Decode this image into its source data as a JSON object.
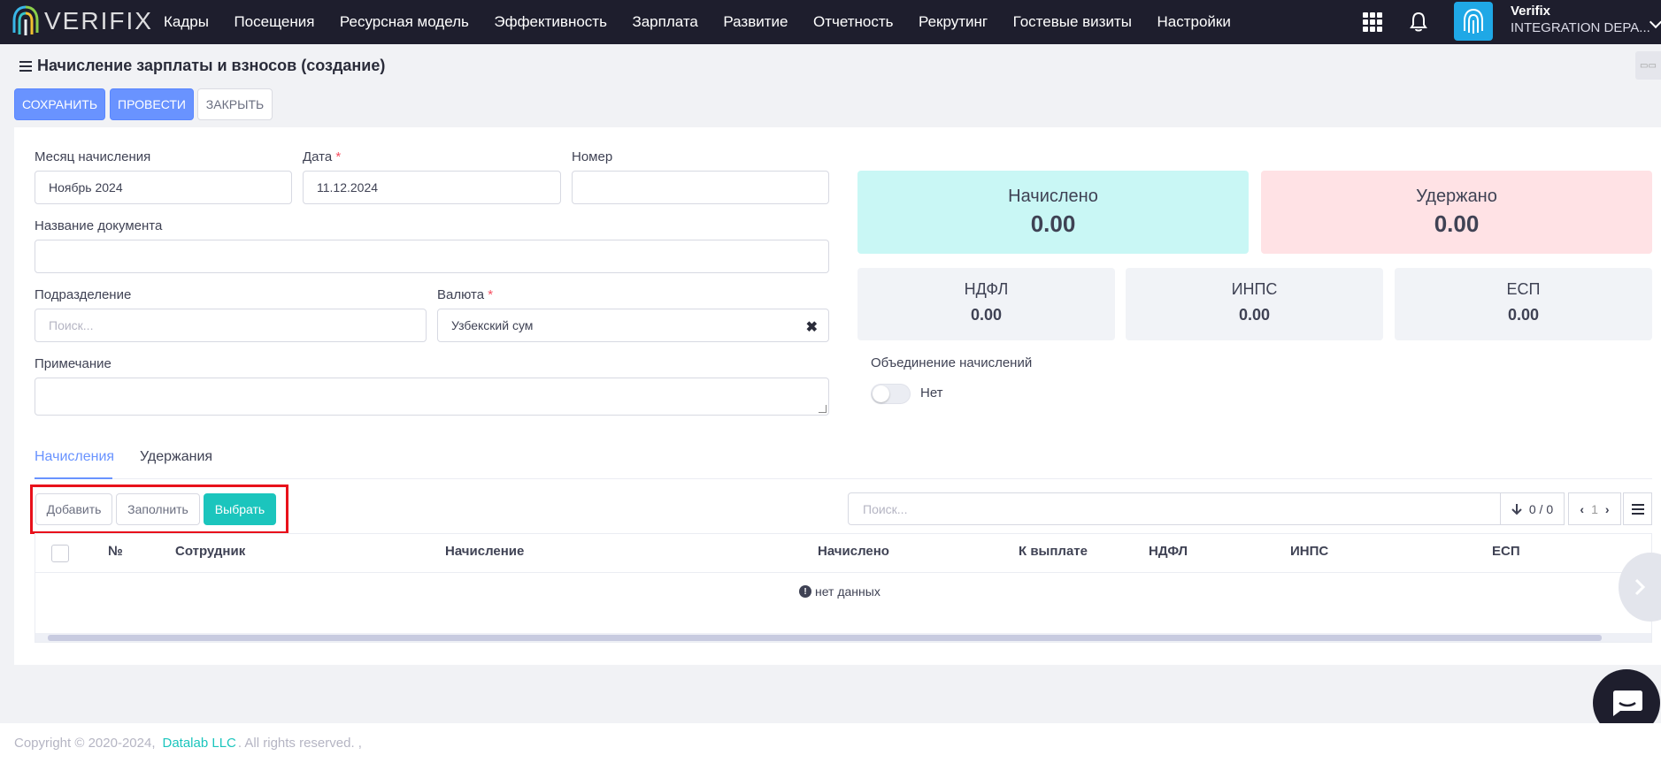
{
  "app": {
    "logo_text": "VERIFIX"
  },
  "nav": [
    "Кадры",
    "Посещения",
    "Ресурсная модель",
    "Эффективность",
    "Зарплата",
    "Развитие",
    "Отчетность",
    "Рекрутинг",
    "Гостевые визиты",
    "Настройки"
  ],
  "user": {
    "name": "Verifix",
    "dept": "INTEGRATION DEPA..."
  },
  "page": {
    "title": "Начисление зарплаты и взносов (создание)"
  },
  "toolbar": {
    "save": "СОХРАНИТЬ",
    "post": "ПРОВЕСТИ",
    "close": "ЗАКРЫТЬ"
  },
  "form": {
    "month_label": "Месяц начисления",
    "month_value": "Ноябрь 2024",
    "date_label": "Дата",
    "date_value": "11.12.2024",
    "required_mark": "*",
    "number_label": "Номер",
    "number_value": "",
    "docname_label": "Название документа",
    "docname_value": "",
    "division_label": "Подразделение",
    "division_placeholder": "Поиск...",
    "currency_label": "Валюта",
    "currency_value": "Узбекский сум",
    "clear_mark": "✖",
    "note_label": "Примечание",
    "note_value": ""
  },
  "stats": {
    "accrued_label": "Начислено",
    "accrued_value": "0.00",
    "withheld_label": "Удержано",
    "withheld_value": "0.00",
    "ndfl_label": "НДФЛ",
    "ndfl_value": "0.00",
    "inps_label": "ИНПС",
    "inps_value": "0.00",
    "esp_label": "ЕСП",
    "esp_value": "0.00"
  },
  "merge": {
    "label": "Объединение начислений",
    "state": "Нет"
  },
  "tabs": [
    "Начисления",
    "Удержания"
  ],
  "actions": {
    "add": "Добавить",
    "fill": "Заполнить",
    "select": "Выбрать"
  },
  "grid": {
    "search_placeholder": "Поиск...",
    "count": "0 / 0",
    "page": "1",
    "columns": [
      "№",
      "Сотрудник",
      "Начисление",
      "Начислено",
      "К выплате",
      "НДФЛ",
      "ИНПС",
      "ЕСП"
    ],
    "empty_text": "нет данных"
  },
  "footer": {
    "copyright": "Copyright © 2020-2024,",
    "company": "Datalab LLC",
    "rights": ". All rights reserved. ,"
  },
  "colors": {
    "primary": "#6993ff",
    "teal": "#1bc5bd",
    "accrued_bg": "#c9f7f5",
    "withheld_bg": "#ffe2e5",
    "highlight": "#e8111b"
  }
}
